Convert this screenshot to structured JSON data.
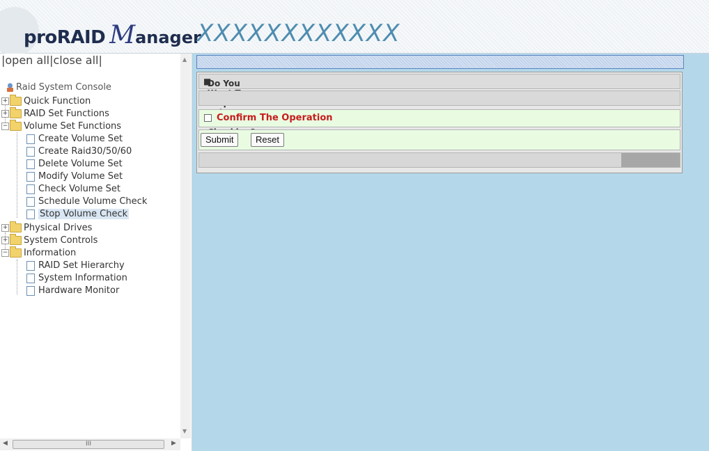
{
  "header": {
    "logo_pro": "pro",
    "logo_raid": "RAID",
    "logo_m": "M",
    "logo_rest": "anager",
    "product": "XXXXXXXXXXXX"
  },
  "sidebar": {
    "open_all": "open all",
    "close_all": "close all",
    "sep": "|",
    "root": "Raid System Console",
    "folders": {
      "quick": "Quick Function",
      "raidset": "RAID Set Functions",
      "volumeset": "Volume Set Functions",
      "physical": "Physical Drives",
      "system": "System Controls",
      "information": "Information"
    },
    "volume_items": [
      "Create Volume Set",
      "Create Raid30/50/60",
      "Delete Volume Set",
      "Modify Volume Set",
      "Check Volume Set",
      "Schedule Volume Check",
      "Stop Volume Check"
    ],
    "info_items": [
      "RAID Set Hierarchy",
      "System Information",
      "Hardware Monitor"
    ],
    "scroll_grip": "III"
  },
  "main": {
    "question": "Do You Want To Stop All Volume Consistency Checking?",
    "confirm_label": "Confirm The Operation",
    "confirm_checked": false,
    "submit_label": "Submit",
    "reset_label": "Reset"
  },
  "colors": {
    "accent_red": "#c71c1c",
    "main_bg": "#b4d8ea",
    "form_green": "#e9fce2"
  }
}
